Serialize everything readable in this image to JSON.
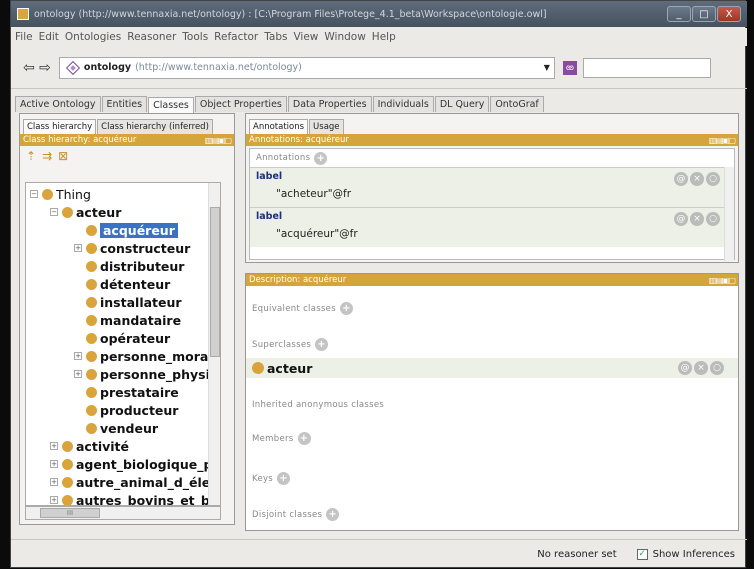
{
  "window": {
    "title": "ontology (http://www.tennaxia.net/ontology) : [C:\\Program Files\\Protege_4.1_beta\\Workspace\\ontologie.owl]",
    "controls": [
      "_",
      "□",
      "X"
    ]
  },
  "menu": [
    "File",
    "Edit",
    "Ontologies",
    "Reasoner",
    "Tools",
    "Refactor",
    "Tabs",
    "View",
    "Window",
    "Help"
  ],
  "address": {
    "name": "ontology",
    "iri": "(http://www.tennaxia.net/ontology)"
  },
  "tabs": [
    "Active Ontology",
    "Entities",
    "Classes",
    "Object Properties",
    "Data Properties",
    "Individuals",
    "DL Query",
    "OntoGraf"
  ],
  "active_tab": "Classes",
  "left_panel": {
    "subtabs": [
      "Class hierarchy",
      "Class hierarchy (inferred)"
    ],
    "header": "Class hierarchy: acquéreur",
    "tree": [
      {
        "label": "Thing",
        "expander": "−"
      },
      {
        "label": "acteur",
        "expander": "−"
      },
      {
        "label": "acquéreur",
        "expander": ""
      },
      {
        "label": "constructeur",
        "expander": "+"
      },
      {
        "label": "distributeur",
        "expander": ""
      },
      {
        "label": "détenteur",
        "expander": ""
      },
      {
        "label": "installateur",
        "expander": ""
      },
      {
        "label": "mandataire",
        "expander": ""
      },
      {
        "label": "opérateur",
        "expander": ""
      },
      {
        "label": "personne_morale",
        "expander": "+"
      },
      {
        "label": "personne_physiq",
        "expander": "+"
      },
      {
        "label": "prestataire",
        "expander": ""
      },
      {
        "label": "producteur",
        "expander": ""
      },
      {
        "label": "vendeur",
        "expander": ""
      },
      {
        "label": "activité",
        "expander": "+"
      },
      {
        "label": "agent_biologique_p",
        "expander": "+"
      },
      {
        "label": "autre_animal_d_élev",
        "expander": "+"
      },
      {
        "label": "autres_bovins_et_bu",
        "expander": "+"
      }
    ],
    "hscroll_label": "III"
  },
  "annotations_panel": {
    "subtabs": [
      "Annotations",
      "Usage"
    ],
    "header": "Annotations: acquéreur",
    "section": "Annotations",
    "rows": [
      {
        "label": "label",
        "value": "\"acheteur\"@fr"
      },
      {
        "label": "label",
        "value": "\"acquéreur\"@fr"
      }
    ]
  },
  "description_panel": {
    "header": "Description: acquéreur",
    "sections": {
      "equivalent": "Equivalent classes",
      "superclasses": "Superclasses",
      "superclass_value": "acteur",
      "inherited": "Inherited anonymous classes",
      "members": "Members",
      "keys": "Keys",
      "disjoint": "Disjoint classes"
    }
  },
  "status": {
    "reasoner": "No reasoner set",
    "show_inferences": "Show Inferences"
  },
  "icons": {
    "header_controls": "▥▤▣▢",
    "row_buttons": [
      "@",
      "×",
      "○"
    ]
  }
}
